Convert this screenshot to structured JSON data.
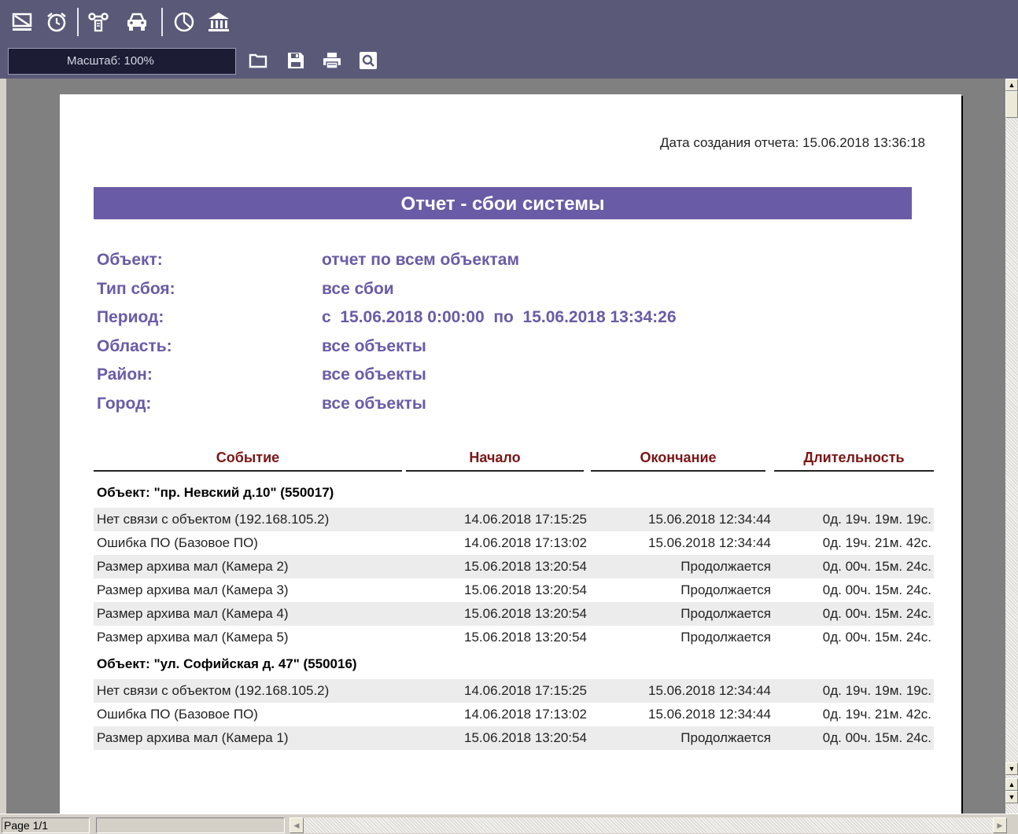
{
  "toolbar": {
    "zoom_label": "Масштаб: 100%",
    "top_icons": [
      "monitor-icon",
      "alarm-clock-icon",
      "network-icon",
      "car-icon",
      "pie-chart-icon",
      "bank-icon"
    ],
    "file_icons": [
      "folder-icon",
      "save-icon",
      "print-icon",
      "search-icon"
    ]
  },
  "status": {
    "page": "Page 1/1"
  },
  "report": {
    "created": "Дата создания отчета: 15.06.2018 13:36:18",
    "title": "Отчет - сбои системы",
    "params": [
      {
        "label": "Объект:",
        "value": "отчет по всем объектам"
      },
      {
        "label": "Тип сбоя:",
        "value": "все сбои"
      },
      {
        "label": "Период:",
        "value": "с  15.06.2018 0:00:00  по  15.06.2018 13:34:26"
      },
      {
        "label": "Область:",
        "value": "все объекты"
      },
      {
        "label": "Район:",
        "value": "все объекты"
      },
      {
        "label": "Город:",
        "value": "все объекты"
      }
    ],
    "columns": [
      "Событие",
      "Начало",
      "Окончание",
      "Длительность"
    ],
    "groups": [
      {
        "title": "Объект: \"пр. Невский д.10\" (550017)",
        "rows": [
          [
            "Нет связи с объектом (192.168.105.2)",
            "14.06.2018 17:15:25",
            "15.06.2018 12:34:44",
            "0д. 19ч. 19м. 19с."
          ],
          [
            "Ошибка ПО (Базовое ПО)",
            "14.06.2018 17:13:02",
            "15.06.2018 12:34:44",
            "0д. 19ч. 21м. 42с."
          ],
          [
            "Размер архива мал (Камера 2)",
            "15.06.2018 13:20:54",
            "Продолжается",
            "0д. 00ч. 15м. 24с."
          ],
          [
            "Размер архива мал (Камера 3)",
            "15.06.2018 13:20:54",
            "Продолжается",
            "0д. 00ч. 15м. 24с."
          ],
          [
            "Размер архива мал (Камера 4)",
            "15.06.2018 13:20:54",
            "Продолжается",
            "0д. 00ч. 15м. 24с."
          ],
          [
            "Размер архива мал (Камера 5)",
            "15.06.2018 13:20:54",
            "Продолжается",
            "0д. 00ч. 15м. 24с."
          ]
        ]
      },
      {
        "title": "Объект: \"ул. Софийская д. 47\" (550016)",
        "rows": [
          [
            "Нет связи с объектом (192.168.105.2)",
            "14.06.2018 17:15:25",
            "15.06.2018 12:34:44",
            "0д. 19ч. 19м. 19с."
          ],
          [
            "Ошибка ПО (Базовое ПО)",
            "14.06.2018 17:13:02",
            "15.06.2018 12:34:44",
            "0д. 19ч. 21м. 42с."
          ],
          [
            "Размер архива мал (Камера 1)",
            "15.06.2018 13:20:54",
            "Продолжается",
            "0д. 00ч. 15м. 24с."
          ]
        ]
      }
    ]
  }
}
